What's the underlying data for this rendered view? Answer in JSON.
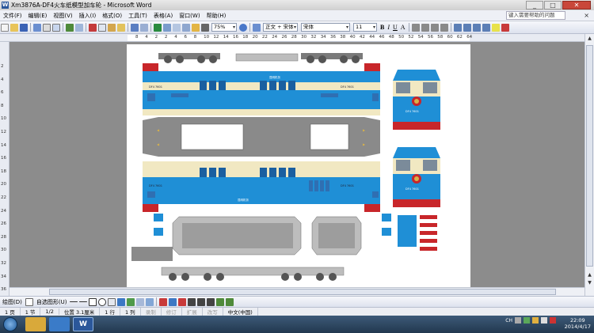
{
  "window": {
    "title": "Xm3876A-DF4火车纸模型加车轮 - Microsoft Word",
    "min": "_",
    "max": "□",
    "close": "✕"
  },
  "menu": {
    "items": [
      "文件(F)",
      "编辑(E)",
      "视图(V)",
      "插入(I)",
      "格式(O)",
      "工具(T)",
      "表格(A)",
      "窗口(W)",
      "帮助(H)"
    ],
    "help_placeholder": "键入需要帮助的问题",
    "close": "×"
  },
  "toolbar": {
    "zoom": "75%",
    "style": "正文 + 宋体",
    "font": "宋体",
    "size": "11",
    "bold": "B",
    "italic": "I",
    "underline": "U",
    "abc": "A"
  },
  "ruler": {
    "top": [
      "8",
      "4",
      "2",
      "2",
      "4",
      "6",
      "8",
      "10",
      "12",
      "14",
      "16",
      "18",
      "20",
      "22",
      "24",
      "26",
      "28",
      "30",
      "32",
      "34",
      "36",
      "38",
      "40",
      "42",
      "44",
      "46",
      "48",
      "50",
      "52",
      "54",
      "56",
      "58",
      "60",
      "62",
      "64"
    ],
    "left": [
      "2",
      "4",
      "6",
      "8",
      "10",
      "12",
      "14",
      "16",
      "18",
      "20",
      "22",
      "24",
      "26",
      "28",
      "30",
      "32",
      "34",
      "36"
    ]
  },
  "drawbar": {
    "draw": "绘图(D)",
    "autoshapes": "自选图形(U)"
  },
  "status": {
    "page": "1 页",
    "section": "1 节",
    "pages": "1/2",
    "position": "位置 3.1厘米",
    "line": "1 行",
    "col": "1 列",
    "rec": "录制",
    "trk": "修订",
    "ext": "扩展",
    "ovr": "改写",
    "lang": "中文(中国)"
  },
  "taskbar": {
    "time": "22:09",
    "date": "2014/4/17",
    "lang": "CH",
    "word_label": "W"
  },
  "model": {
    "side_label_1": "DF4 7601",
    "side_label_2": "DF4 7601",
    "side_label_3": "DF4 7601",
    "side_label_4": "DF4 7601",
    "cab_label_1": "DF4 7601",
    "cab_label_2": "DF4 7601",
    "plate_1": "昆明机务",
    "plate_2": "昆明机务"
  },
  "colors": {
    "body_blue": "#1f8fd6",
    "body_cream": "#f1e8c2",
    "roof_gray": "#8a8a8a",
    "red": "#c8262a",
    "gold": "#d7b14a"
  }
}
